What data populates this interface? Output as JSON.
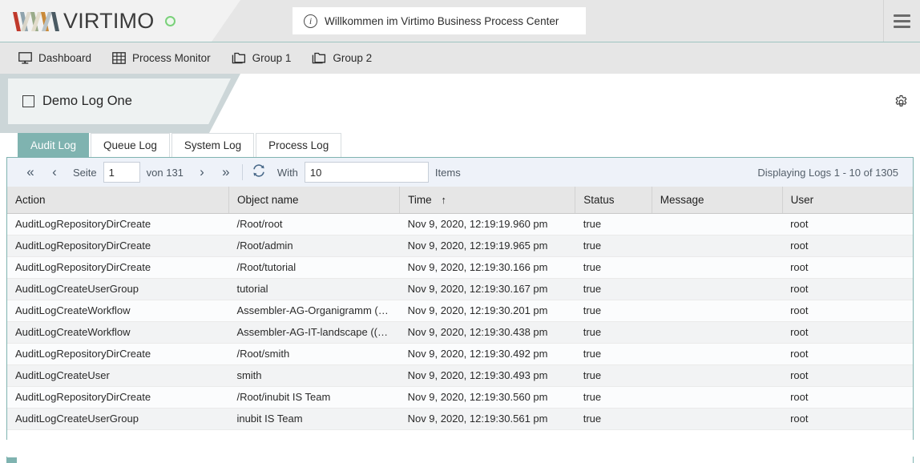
{
  "brand": {
    "name": "VIRTIMO",
    "logo_colors": [
      "#c0392b",
      "#8fa3ad",
      "#e8e0cf",
      "#9aab8a",
      "#c98a3a",
      "#6b7c88",
      "#3b3b3b"
    ],
    "status_color": "#7ad17a",
    "accent_color": "#7fb3b0"
  },
  "header": {
    "info_icon": "info-icon",
    "info_text": "Willkommen im Virtimo Business Process Center",
    "menu_icon": "hamburger-icon"
  },
  "nav": {
    "items": [
      {
        "label": "Dashboard",
        "icon": "monitor-icon"
      },
      {
        "label": "Process Monitor",
        "icon": "grid-table-icon"
      },
      {
        "label": "Group 1",
        "icon": "folder-icon"
      },
      {
        "label": "Group 2",
        "icon": "folder-icon"
      }
    ]
  },
  "document": {
    "tab_label": "Demo Log One",
    "checkbox_icon": "checkbox-icon",
    "settings_icon": "gear-icon"
  },
  "log_tabs": {
    "active": "Audit Log",
    "items": [
      "Audit Log",
      "Queue Log",
      "System Log",
      "Process Log"
    ]
  },
  "pager": {
    "first_icon": "double-chevron-left-icon",
    "prev_icon": "chevron-left-icon",
    "next_icon": "chevron-right-icon",
    "last_icon": "double-chevron-right-icon",
    "refresh_icon": "refresh-icon",
    "page_label": "Seite",
    "page_value": "1",
    "of_label": "von 131",
    "with_label": "With",
    "items_value": "10",
    "items_label": "Items",
    "displaying": "Displaying Logs 1 - 10 of 1305"
  },
  "table": {
    "columns": [
      {
        "key": "action",
        "label": "Action",
        "sort": ""
      },
      {
        "key": "object",
        "label": "Object name",
        "sort": ""
      },
      {
        "key": "time",
        "label": "Time",
        "sort": "↑"
      },
      {
        "key": "status",
        "label": "Status",
        "sort": ""
      },
      {
        "key": "message",
        "label": "Message",
        "sort": ""
      },
      {
        "key": "user",
        "label": "User",
        "sort": ""
      }
    ],
    "rows": [
      {
        "action": "AuditLogRepositoryDirCreate",
        "object": "/Root/root",
        "time": "Nov 9, 2020, 12:19:19.960 pm",
        "status": "true",
        "message": "",
        "user": "root"
      },
      {
        "action": "AuditLogRepositoryDirCreate",
        "object": "/Root/admin",
        "time": "Nov 9, 2020, 12:19:19.965 pm",
        "status": "true",
        "message": "",
        "user": "root"
      },
      {
        "action": "AuditLogRepositoryDirCreate",
        "object": "/Root/tutorial",
        "time": "Nov 9, 2020, 12:19:30.166 pm",
        "status": "true",
        "message": "",
        "user": "root"
      },
      {
        "action": "AuditLogCreateUserGroup",
        "object": "tutorial",
        "time": "Nov 9, 2020, 12:19:30.167 pm",
        "status": "true",
        "message": "",
        "user": "root"
      },
      {
        "action": "AuditLogCreateWorkflow",
        "object": "Assembler-AG-Organigramm ((…",
        "time": "Nov 9, 2020, 12:19:30.201 pm",
        "status": "true",
        "message": "",
        "user": "root"
      },
      {
        "action": "AuditLogCreateWorkflow",
        "object": "Assembler-AG-IT-landscape ((…",
        "time": "Nov 9, 2020, 12:19:30.438 pm",
        "status": "true",
        "message": "",
        "user": "root"
      },
      {
        "action": "AuditLogRepositoryDirCreate",
        "object": "/Root/smith",
        "time": "Nov 9, 2020, 12:19:30.492 pm",
        "status": "true",
        "message": "",
        "user": "root"
      },
      {
        "action": "AuditLogCreateUser",
        "object": "smith",
        "time": "Nov 9, 2020, 12:19:30.493 pm",
        "status": "true",
        "message": "",
        "user": "root"
      },
      {
        "action": "AuditLogRepositoryDirCreate",
        "object": "/Root/inubit IS Team",
        "time": "Nov 9, 2020, 12:19:30.560 pm",
        "status": "true",
        "message": "",
        "user": "root"
      },
      {
        "action": "AuditLogCreateUserGroup",
        "object": "inubit IS Team",
        "time": "Nov 9, 2020, 12:19:30.561 pm",
        "status": "true",
        "message": "",
        "user": "root"
      }
    ]
  }
}
